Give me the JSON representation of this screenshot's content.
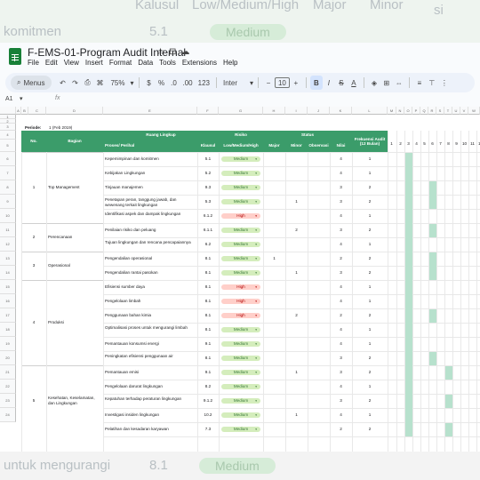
{
  "backdrop": {
    "top_texts": [
      "Kalusul",
      "Low/Medium/High",
      "Major",
      "Minor",
      "si"
    ],
    "top_row": {
      "label": "komitmen",
      "value": "5.1",
      "chip": "Medium"
    },
    "bottom_row": {
      "label": "untuk mengurangi",
      "value": "8.1",
      "chip": "Medium"
    }
  },
  "window": {
    "title": "F-EMS-01-Program Audit Internal",
    "title_icons": [
      "star-icon",
      "folder-icon",
      "cloud-icon"
    ],
    "menu": [
      "File",
      "Edit",
      "View",
      "Insert",
      "Format",
      "Data",
      "Tools",
      "Extensions",
      "Help"
    ]
  },
  "toolbar": {
    "search_label": "Menus",
    "zoom": "75%",
    "currency": "$",
    "percent": "%",
    "dec_decrease": ".0",
    "dec_increase": ".00",
    "number_format": "123",
    "font": "Inter",
    "font_size": "10",
    "minus": "−",
    "plus": "+",
    "bold": "B",
    "italic": "I",
    "strike": "S",
    "text_color": "A"
  },
  "formula_bar": {
    "cell_ref": "A1",
    "fx": "fx",
    "value": ""
  },
  "columns": [
    "A",
    "B",
    "C",
    "D",
    "E",
    "F",
    "G",
    "H",
    "I",
    "J",
    "K",
    "L",
    "M",
    "N",
    "O",
    "P",
    "Q",
    "R",
    "S",
    "T",
    "U",
    "V",
    "W"
  ],
  "periode": {
    "label": "Periode:",
    "value": "1 (Feb 2019)"
  },
  "table": {
    "headers": {
      "no": "No.",
      "bagian": "Bagian",
      "ruang_lingkup": "Ruang Lingkup",
      "proses": "Proses/ Perihal",
      "klausul": "Klausul",
      "risiko": "Risiko",
      "lmh": "Low/Medium/High",
      "status": "Status",
      "major": "Major",
      "minor": "Minor",
      "observasi": "Observasi",
      "nilai": "Nilai",
      "frekuensi": "Frekuensi Audit (12 Bulan)",
      "months": [
        "1",
        "2",
        "3",
        "4",
        "5",
        "6",
        "7",
        "8",
        "9",
        "10",
        "11",
        "12"
      ]
    },
    "rows": [
      {
        "proses": "Kepemimpinan dan komitmen",
        "klausul": "5.1",
        "risk": "Medium",
        "major": "",
        "minor": "",
        "obs": "",
        "nilai": "4",
        "frek": "1"
      },
      {
        "proses": "Kebijakan Lingkungan",
        "klausul": "5.2",
        "risk": "Medium",
        "major": "",
        "minor": "",
        "obs": "",
        "nilai": "4",
        "frek": "1"
      },
      {
        "proses": "Tinjauan manajemen",
        "klausul": "9.3",
        "risk": "Medium",
        "major": "",
        "minor": "",
        "obs": "",
        "nilai": "3",
        "frek": "2"
      },
      {
        "proses": "Penetapan peran, tanggung jawab, dan wewenang terkait lingkungan",
        "klausul": "5.3",
        "risk": "Medium",
        "major": "",
        "minor": "1",
        "obs": "",
        "nilai": "3",
        "frek": "2"
      },
      {
        "proses": "Identifikasi aspek dan dampak lingkungan",
        "klausul": "6.1.2",
        "risk": "High",
        "major": "",
        "minor": "",
        "obs": "",
        "nilai": "4",
        "frek": "1"
      },
      {
        "proses": "Penilaian risiko dan peluang",
        "klausul": "6.1.1",
        "risk": "Medium",
        "major": "",
        "minor": "2",
        "obs": "",
        "nilai": "3",
        "frek": "2"
      },
      {
        "proses": "Tujuan lingkungan dan rencana pencapaiannya",
        "klausul": "6.2",
        "risk": "Medium",
        "major": "",
        "minor": "",
        "obs": "",
        "nilai": "4",
        "frek": "1"
      },
      {
        "proses": "Pengendalian operasional",
        "klausul": "8.1",
        "risk": "Medium",
        "major": "1",
        "minor": "",
        "obs": "",
        "nilai": "2",
        "frek": "2"
      },
      {
        "proses": "Pengendalian rantai pasokan",
        "klausul": "8.1",
        "risk": "Medium",
        "major": "",
        "minor": "1",
        "obs": "",
        "nilai": "3",
        "frek": "2"
      },
      {
        "proses": "Efisiensi sumber daya",
        "klausul": "8.1",
        "risk": "High",
        "major": "",
        "minor": "",
        "obs": "",
        "nilai": "4",
        "frek": "1"
      },
      {
        "proses": "Pengelolaan limbah",
        "klausul": "8.1",
        "risk": "High",
        "major": "",
        "minor": "",
        "obs": "",
        "nilai": "4",
        "frek": "1"
      },
      {
        "proses": "Penggunaan bahan kimia",
        "klausul": "8.1",
        "risk": "High",
        "major": "",
        "minor": "2",
        "obs": "",
        "nilai": "2",
        "frek": "2"
      },
      {
        "proses": "Optimalisasi proses untuk mengurangi limbah",
        "klausul": "8.1",
        "risk": "Medium",
        "major": "",
        "minor": "",
        "obs": "",
        "nilai": "4",
        "frek": "1"
      },
      {
        "proses": "Pemantauan konsumsi energi",
        "klausul": "9.1",
        "risk": "Medium",
        "major": "",
        "minor": "",
        "obs": "",
        "nilai": "4",
        "frek": "1"
      },
      {
        "proses": "Peningkatan efisiensi penggunaan air",
        "klausul": "8.1",
        "risk": "Medium",
        "major": "",
        "minor": "",
        "obs": "",
        "nilai": "3",
        "frek": "2"
      },
      {
        "proses": "Pemantauan emisi",
        "klausul": "9.1",
        "risk": "Medium",
        "major": "",
        "minor": "1",
        "obs": "",
        "nilai": "3",
        "frek": "2"
      },
      {
        "proses": "Pengelolaan darurat lingkungan",
        "klausul": "8.2",
        "risk": "Medium",
        "major": "",
        "minor": "",
        "obs": "",
        "nilai": "4",
        "frek": "1"
      },
      {
        "proses": "Kepatuhan terhadap peraturan lingkungan",
        "klausul": "9.1.2",
        "risk": "Medium",
        "major": "",
        "minor": "",
        "obs": "",
        "nilai": "3",
        "frek": "2"
      },
      {
        "proses": "Investigasi insiden lingkungan",
        "klausul": "10.2",
        "risk": "Medium",
        "major": "",
        "minor": "1",
        "obs": "",
        "nilai": "4",
        "frek": "1"
      },
      {
        "proses": "Pelatihan dan kesadaran karyawan",
        "klausul": "7.3",
        "risk": "Medium",
        "major": "",
        "minor": "",
        "obs": "",
        "nilai": "2",
        "frek": "2"
      }
    ],
    "groups": [
      {
        "no": "1",
        "bagian": "Top Management"
      },
      {
        "no": "2",
        "bagian": "Perencanaan"
      },
      {
        "no": "3",
        "bagian": "Operasional"
      },
      {
        "no": "4",
        "bagian": "Produksi"
      },
      {
        "no": "5",
        "bagian": "Kesehatan, Keselamatan, dan Lingkungan"
      }
    ],
    "row_numbers": [
      "1",
      "2",
      "3",
      "4",
      "5",
      "6",
      "7",
      "8",
      "9",
      "10",
      "11",
      "12",
      "13",
      "14",
      "15",
      "16",
      "17",
      "18",
      "19",
      "20",
      "21",
      "22",
      "23",
      "24"
    ]
  },
  "colors": {
    "header_green": "#3b9c6a",
    "medium_chip": "#d4edbc",
    "high_chip": "#ffcfc9",
    "gantt_fill": "#b7e1cd"
  }
}
